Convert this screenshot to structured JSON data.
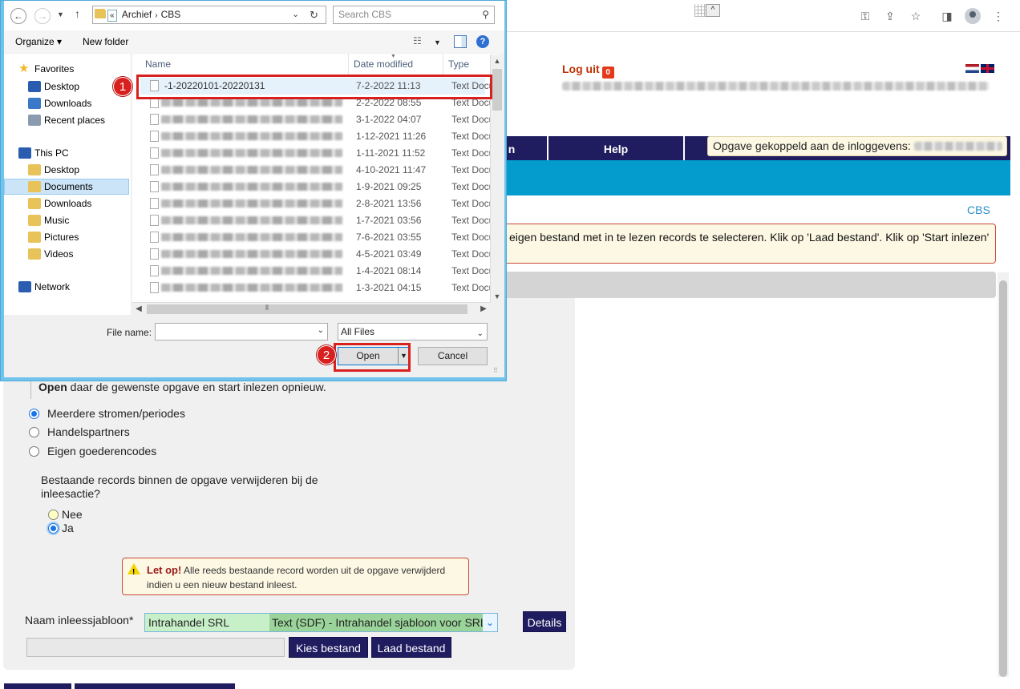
{
  "browser": {
    "toolbar_icons": [
      "translate-icon",
      "share-icon",
      "star-icon",
      "sidepanel-icon",
      "profile-icon",
      "menu-icon"
    ]
  },
  "page": {
    "logout_label": "Log uit",
    "logout_icon_glyph": "0",
    "nav_tabs": [
      {
        "label": "n"
      },
      {
        "label": "Help"
      }
    ],
    "tooltip_text": "Opgave gekoppeld aan de inloggevens:",
    "cbs_link": "CBS",
    "info_text": "eigen bestand met in te lezen records te selecteren. Klik op 'Laad bestand'. Klik op 'Start inlezen'",
    "open_instruction_bold": "Open",
    "open_instruction_rest": " daar de gewenste opgave en start inlezen opnieuw.",
    "type_options": [
      {
        "label": "Meerdere stromen/periodes",
        "selected": true
      },
      {
        "label": "Handelspartners",
        "selected": false
      },
      {
        "label": "Eigen goederencodes",
        "selected": false
      }
    ],
    "delete_question": "Bestaande records binnen de opgave verwijderen bij de inleesactie?",
    "delete_options": [
      {
        "label": "Nee",
        "selected": false
      },
      {
        "label": "Ja",
        "selected": true
      }
    ],
    "warning_title": "Let op!",
    "warning_text": " Alle reeds bestaande record worden uit de opgave verwijderd indien u een nieuw bestand inleest.",
    "template_label": "Naam inleessjabloon*",
    "template_name": "Intrahandel SRL",
    "template_desc": "Text (SDF) - Intrahandel sjabloon voor SRL",
    "details_button": "Details",
    "choose_file_button": "Kies bestand",
    "load_file_button": "Laad bestand"
  },
  "dialog": {
    "breadcrumb": [
      "Archief",
      "CBS"
    ],
    "search_placeholder": "Search CBS",
    "organize_label": "Organize",
    "new_folder_label": "New folder",
    "nav_items": [
      {
        "label": "Favorites",
        "icon": "star-icon",
        "color": "#f1b828"
      },
      {
        "label": "Desktop",
        "icon": "desktop-icon",
        "color": "#2a5db0"
      },
      {
        "label": "Downloads",
        "icon": "downloads-folder-icon",
        "color": "#3a78c8"
      },
      {
        "label": "Recent places",
        "icon": "recent-places-icon",
        "color": "#8a9bb0"
      },
      {
        "label": "This PC",
        "icon": "computer-icon",
        "color": "#2a5db0"
      },
      {
        "label": "Desktop",
        "icon": "desktop-folder-icon",
        "color": "#e8c35a"
      },
      {
        "label": "Documents",
        "icon": "documents-folder-icon",
        "color": "#e8c35a",
        "selected": true
      },
      {
        "label": "Downloads",
        "icon": "downloads-folder-icon",
        "color": "#e8c35a"
      },
      {
        "label": "Music",
        "icon": "music-folder-icon",
        "color": "#e8c35a"
      },
      {
        "label": "Pictures",
        "icon": "pictures-folder-icon",
        "color": "#e8c35a"
      },
      {
        "label": "Videos",
        "icon": "videos-folder-icon",
        "color": "#e8c35a"
      },
      {
        "label": "Network",
        "icon": "network-icon",
        "color": "#2a5db0"
      }
    ],
    "columns": {
      "name": "Name",
      "date": "Date modified",
      "type": "Type"
    },
    "files": [
      {
        "name": "-1-20220101-20220131",
        "date": "7-2-2022 11:13",
        "type": "Text Docu"
      },
      {
        "name": "",
        "date": "2-2-2022 08:55",
        "type": "Text Docu"
      },
      {
        "name": "",
        "date": "3-1-2022 04:07",
        "type": "Text Docu"
      },
      {
        "name": "",
        "date": "1-12-2021 11:26",
        "type": "Text Docu"
      },
      {
        "name": "",
        "date": "1-11-2021 11:52",
        "type": "Text Docu"
      },
      {
        "name": "",
        "date": "4-10-2021 11:47",
        "type": "Text Docu"
      },
      {
        "name": "",
        "date": "1-9-2021 09:25",
        "type": "Text Docu"
      },
      {
        "name": "",
        "date": "2-8-2021 13:56",
        "type": "Text Docu"
      },
      {
        "name": "",
        "date": "1-7-2021 03:56",
        "type": "Text Docu"
      },
      {
        "name": "",
        "date": "7-6-2021 03:55",
        "type": "Text Docu"
      },
      {
        "name": "",
        "date": "4-5-2021 03:49",
        "type": "Text Docu"
      },
      {
        "name": "",
        "date": "1-4-2021 08:14",
        "type": "Text Docu"
      },
      {
        "name": "",
        "date": "1-3-2021 04:15",
        "type": "Text Docu"
      }
    ],
    "file_name_label": "File name:",
    "file_name_value": "",
    "filter_value": "All Files",
    "open_button": "Open",
    "cancel_button": "Cancel"
  },
  "annotations": {
    "badge_1": "1",
    "badge_2": "2",
    "color": "#d8201f"
  }
}
